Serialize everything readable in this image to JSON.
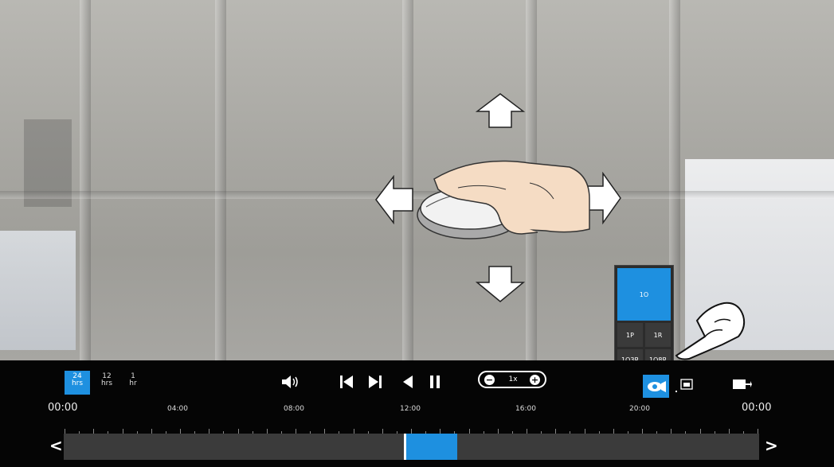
{
  "range_buttons": [
    {
      "num": "24",
      "unit": "hrs"
    },
    {
      "num": "12",
      "unit": "hrs"
    },
    {
      "num": "1",
      "unit": "hr"
    }
  ],
  "speed": {
    "minus": "−",
    "value": "1x",
    "plus": "+"
  },
  "timeline": {
    "start": "00:00",
    "end": "00:00",
    "labels": [
      "04:00",
      "08:00",
      "12:00",
      "16:00",
      "20:00"
    ]
  },
  "nav": {
    "prev": "<",
    "next": ">"
  },
  "stream_popup": {
    "selected": "1O",
    "options": [
      "1P",
      "1R",
      "1O3R",
      "1O8R"
    ]
  },
  "colors": {
    "accent": "#1e90e0",
    "bar": "#050505"
  },
  "icons": [
    "volume-icon",
    "skip-start-icon",
    "skip-end-icon",
    "reverse-play-icon",
    "pause-icon",
    "eye-icon",
    "snapshot-icon",
    "export-icon",
    "mouse-hand-illustration",
    "pointing-hand-illustration"
  ]
}
